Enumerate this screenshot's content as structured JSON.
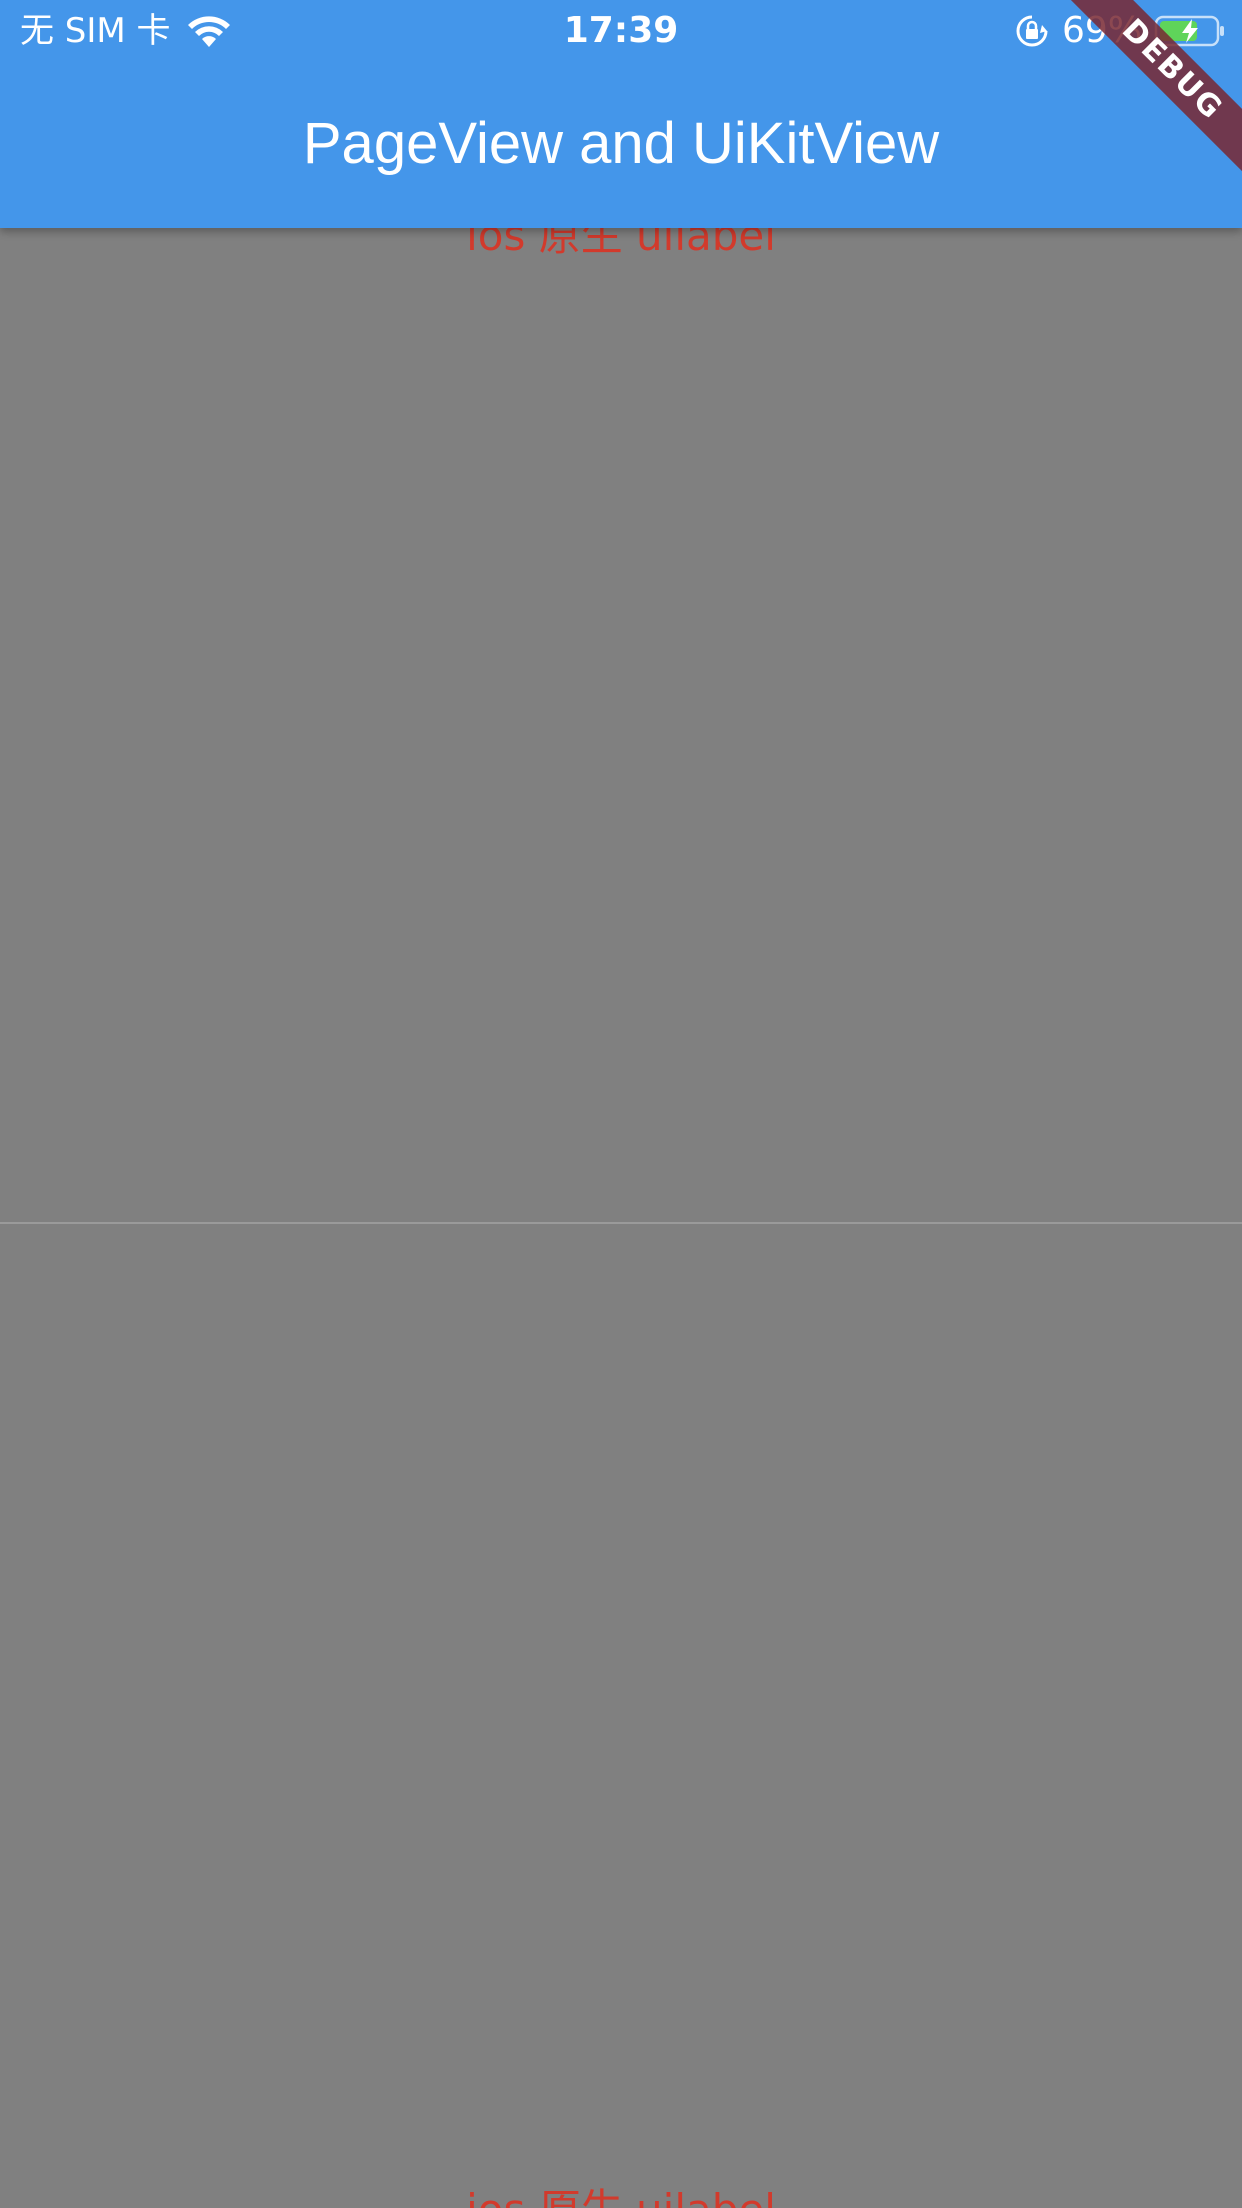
{
  "status_bar": {
    "carrier": "无 SIM 卡",
    "time": "17:39",
    "battery_percent": "69%"
  },
  "app_bar": {
    "title": "PageView and UiKitView"
  },
  "debug_banner": {
    "label": "DEBUG"
  },
  "pages": [
    {
      "label": "ios 原生 uilabel"
    },
    {
      "label": "ios 原生 uilabel"
    }
  ],
  "colors": {
    "app_bar": "#4496EA",
    "page_background": "#808080",
    "label_text": "#d23a2c"
  }
}
